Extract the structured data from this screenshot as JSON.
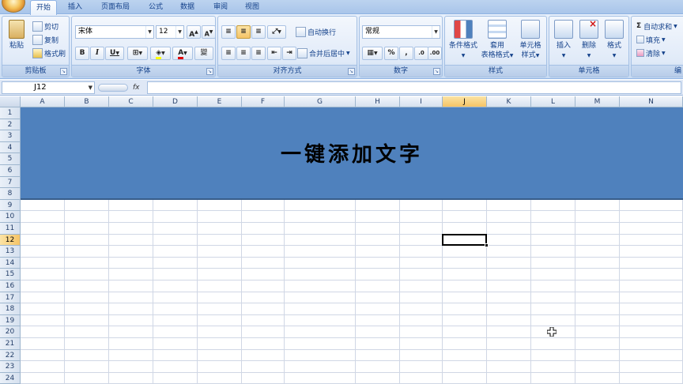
{
  "ribbon_tabs": [
    {
      "label": "开始",
      "active": true
    },
    {
      "label": "插入",
      "active": false
    },
    {
      "label": "页面布局",
      "active": false
    },
    {
      "label": "公式",
      "active": false
    },
    {
      "label": "数据",
      "active": false
    },
    {
      "label": "审阅",
      "active": false
    },
    {
      "label": "视图",
      "active": false
    }
  ],
  "clipboard": {
    "title": "剪贴板",
    "paste": "粘贴",
    "cut": "剪切",
    "copy": "复制",
    "format_painter": "格式刷"
  },
  "font": {
    "title": "字体",
    "name": "宋体",
    "size": "12",
    "grow": "A",
    "shrink": "A",
    "bold": "B",
    "italic": "I",
    "underline": "U",
    "font_color": "A",
    "phonetic": "變"
  },
  "alignment": {
    "title": "对齐方式",
    "wrap_text": "自动换行",
    "merge_center": "合并后居中"
  },
  "number": {
    "title": "数字",
    "format": "常规",
    "percent": "%",
    "comma": ","
  },
  "styles": {
    "title": "样式",
    "conditional": "条件格式",
    "table_line1": "套用",
    "table_line2": "表格格式",
    "cell_line1": "单元格",
    "cell_line2": "样式"
  },
  "cells": {
    "title": "单元格",
    "insert": "插入",
    "delete": "删除",
    "format": "格式"
  },
  "editing": {
    "title": "编",
    "autosum": "自动求和",
    "fill": "填充",
    "clear": "清除"
  },
  "formula_bar": {
    "name_box": "J12",
    "fx": "fx",
    "content": ""
  },
  "sheet": {
    "columns": [
      "A",
      "B",
      "C",
      "D",
      "E",
      "F",
      "G",
      "H",
      "I",
      "J",
      "K",
      "L",
      "M",
      "N"
    ],
    "rows": [
      "1",
      "2",
      "3",
      "4",
      "5",
      "6",
      "7",
      "8",
      "9",
      "10",
      "11",
      "12",
      "13",
      "14",
      "15",
      "16",
      "17",
      "18",
      "19",
      "20",
      "21",
      "22",
      "23",
      "24"
    ],
    "selected_column": "J",
    "selected_row": "12",
    "banner_text": "一键添加文字",
    "banner_color": "#4f81bd"
  }
}
